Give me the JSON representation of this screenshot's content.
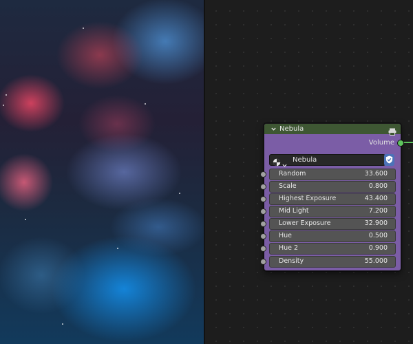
{
  "node": {
    "title": "Nebula",
    "output_label": "Volume",
    "selector_name": "Nebula",
    "header_color": "#3e5733",
    "body_color": "#7b5da6",
    "socket_color_output": "#5ec45e",
    "socket_color_input": "#a1a1a1",
    "fields": [
      {
        "label": "Random",
        "value": "33.600"
      },
      {
        "label": "Scale",
        "value": "0.800"
      },
      {
        "label": "Highest Exposure",
        "value": "43.400"
      },
      {
        "label": "Mid Light",
        "value": "7.200"
      },
      {
        "label": "Lower Exposure",
        "value": "32.900"
      },
      {
        "label": "Hue",
        "value": "0.500"
      },
      {
        "label": "Hue 2",
        "value": "0.900"
      },
      {
        "label": "Density",
        "value": "55.000"
      }
    ]
  },
  "icons": {
    "collapse": "chevron-down-icon",
    "node_group": "node-group-icon",
    "material": "sphere-icon",
    "fake_user": "shield-icon"
  }
}
